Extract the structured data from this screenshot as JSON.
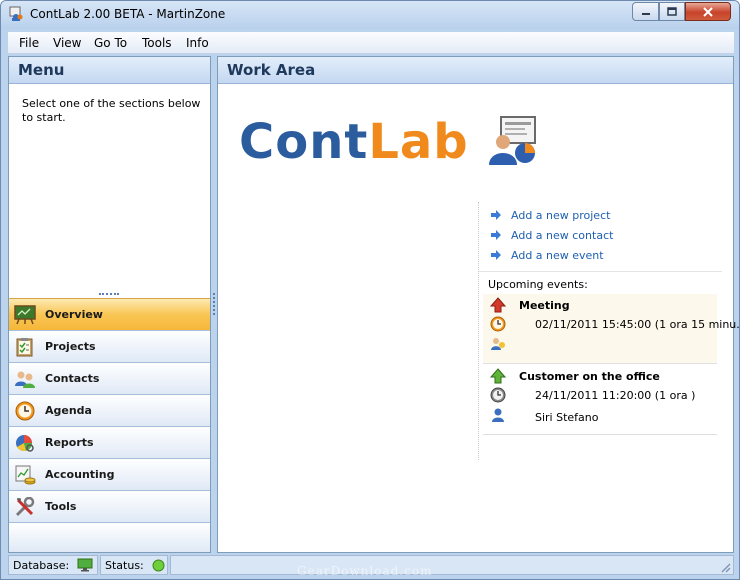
{
  "window": {
    "title": "ContLab 2.00 BETA - MartinZone",
    "minimize_label": "",
    "maximize_label": "",
    "close_label": ""
  },
  "menubar": {
    "items": [
      "File",
      "View",
      "Go To",
      "Tools",
      "Info"
    ]
  },
  "menu_panel": {
    "title": "Menu",
    "description": "Select one of the sections below to start.",
    "items": [
      {
        "label": "Overview",
        "icon": "overview-icon",
        "active": true
      },
      {
        "label": "Projects",
        "icon": "clipboard-icon",
        "active": false
      },
      {
        "label": "Contacts",
        "icon": "contacts-icon",
        "active": false
      },
      {
        "label": "Agenda",
        "icon": "clock-icon",
        "active": false
      },
      {
        "label": "Reports",
        "icon": "pie-chart-icon",
        "active": false
      },
      {
        "label": "Accounting",
        "icon": "accounting-icon",
        "active": false
      },
      {
        "label": "Tools",
        "icon": "tools-icon",
        "active": false
      }
    ]
  },
  "work_area": {
    "title": "Work Area",
    "logo": {
      "part1": "Cont",
      "part2": "Lab"
    },
    "quick_links": [
      {
        "label": "Add a new project",
        "icon": "arrow-right-icon"
      },
      {
        "label": "Add a new contact",
        "icon": "arrow-right-icon"
      },
      {
        "label": "Add a new event",
        "icon": "arrow-right-icon"
      }
    ],
    "events_title": "Upcoming events:",
    "events": [
      {
        "title": "Meeting",
        "time": "02/11/2011 15:45:00 (1 ora 15 minu...",
        "person": "",
        "priority": "up-red"
      },
      {
        "title": "Customer on the office",
        "time": "24/11/2011 11:20:00 (1 ora )",
        "person": "Siri Stefano",
        "priority": "up-green"
      }
    ]
  },
  "statusbar": {
    "database_label": "Database:",
    "status_label": "Status:"
  },
  "watermark": "GearDownload.com",
  "colors": {
    "logo_blue": "#2b5d9e",
    "logo_orange": "#f08a1c",
    "link_blue": "#1f5fb0",
    "active_nav": "#f9c654"
  }
}
